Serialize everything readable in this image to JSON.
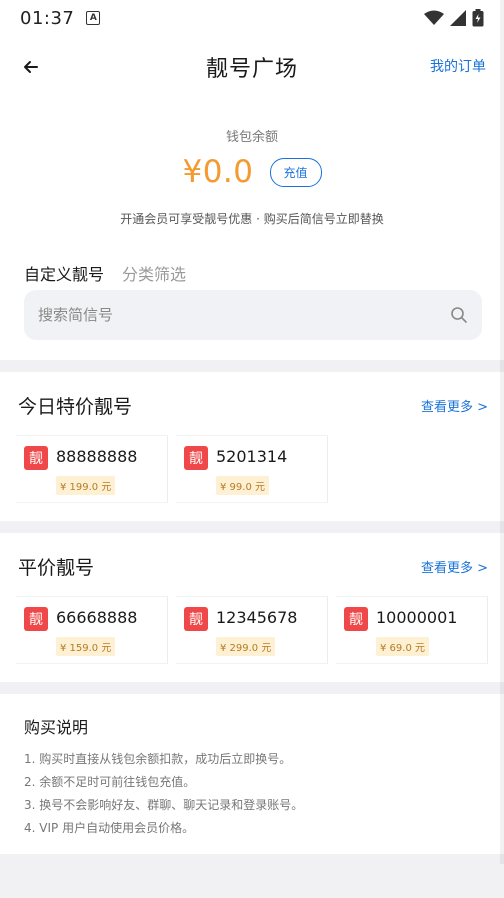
{
  "status": {
    "time": "01:37"
  },
  "header": {
    "title": "靓号广场",
    "my_orders": "我的订单"
  },
  "wallet": {
    "label": "钱包余额",
    "balance": "¥0.0",
    "recharge": "充值",
    "tip": "开通会员可享受靓号优惠 · 购买后简信号立即替换"
  },
  "tabs": [
    {
      "label": "自定义靓号"
    },
    {
      "label": "分类筛选"
    }
  ],
  "search": {
    "placeholder": "搜索简信号"
  },
  "today": {
    "title": "今日特价靓号",
    "more": "查看更多 >",
    "items": [
      {
        "badge": "靓",
        "number": "88888888",
        "price": "¥ 199.0 元"
      },
      {
        "badge": "靓",
        "number": "5201314",
        "price": "¥ 99.0 元"
      }
    ]
  },
  "flat": {
    "title": "平价靓号",
    "more": "查看更多 >",
    "items": [
      {
        "badge": "靓",
        "number": "66668888",
        "price": "¥ 159.0 元"
      },
      {
        "badge": "靓",
        "number": "12345678",
        "price": "¥ 299.0 元"
      },
      {
        "badge": "靓",
        "number": "10000001",
        "price": "¥ 69.0 元"
      }
    ]
  },
  "purchase": {
    "title": "购买说明",
    "items": [
      "1. 购买时直接从钱包余额扣款，成功后立即换号。",
      "2. 余额不足时可前往钱包充值。",
      "3. 换号不会影响好友、群聊、聊天记录和登录账号。",
      "4. VIP 用户自动使用会员价格。"
    ]
  },
  "colors": {
    "accent": "#1a73d9",
    "balance": "#f39a30",
    "badge": "#f04848"
  },
  "icons": {
    "back": "arrow-left-icon",
    "search": "search-icon",
    "wifi": "wifi-icon",
    "signal": "signal-icon",
    "battery": "battery-icon"
  }
}
